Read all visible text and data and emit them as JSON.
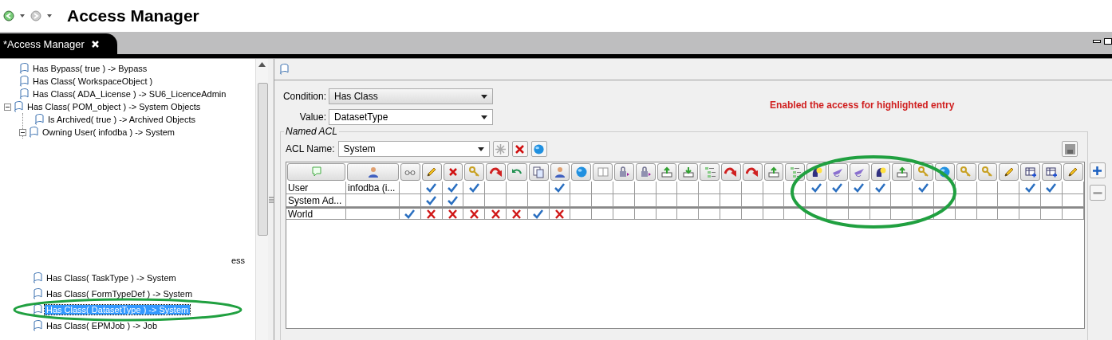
{
  "toolbar": {
    "title": "Access Manager"
  },
  "tab": {
    "label": "*Access Manager"
  },
  "tree": {
    "items": [
      {
        "label": "Has Bypass( true ) -> Bypass",
        "expanded": false,
        "selected": false
      },
      {
        "label": "Has Class( WorkspaceObject )",
        "expanded": false,
        "selected": false
      },
      {
        "label": "Has Class( ADA_License ) -> SU6_LicenceAdmin",
        "expanded": false,
        "selected": false
      },
      {
        "label": "Has Class( POM_object ) -> System Objects",
        "expanded": true,
        "selected": false,
        "children": [
          {
            "label": "Is Archived( true ) -> Archived Objects",
            "expanded": false,
            "selected": false
          },
          {
            "label": "Owning User( infodba ) -> System",
            "expanded": true,
            "selected": false
          }
        ]
      }
    ],
    "fragment": "ess",
    "lower_items": [
      {
        "label": "Has Class( TaskType ) -> System",
        "selected": false
      },
      {
        "label": "Has Class( FormTypeDef ) -> System",
        "selected": false
      },
      {
        "label": "Has Class( DatasetType ) -> System",
        "selected": true
      },
      {
        "label": "Has Class( EPMJob ) -> Job",
        "selected": false
      }
    ]
  },
  "detail": {
    "condition_label": "Condition:",
    "condition": "Has Class",
    "value_label": "Value:",
    "value": "DatasetType",
    "note": "Enabled the access for highlighted entry",
    "group_title": "Named ACL",
    "acl_label": "ACL Name:",
    "acl": "System"
  },
  "acl_table": {
    "rows": [
      {
        "type": "User",
        "name": "infodba (i...",
        "cells": [
          {
            "kind": "empty"
          },
          {
            "kind": "check"
          },
          {
            "kind": "check"
          },
          {
            "kind": "check"
          },
          {
            "kind": "empty"
          },
          {
            "kind": "empty"
          },
          {
            "kind": "empty"
          },
          {
            "kind": "check"
          },
          {
            "kind": "empty"
          },
          {
            "kind": "empty"
          },
          {
            "kind": "empty"
          },
          {
            "kind": "empty"
          },
          {
            "kind": "empty"
          },
          {
            "kind": "empty"
          },
          {
            "kind": "empty"
          },
          {
            "kind": "empty"
          },
          {
            "kind": "empty"
          },
          {
            "kind": "empty"
          },
          {
            "kind": "empty"
          },
          {
            "kind": "check"
          },
          {
            "kind": "check"
          },
          {
            "kind": "check"
          },
          {
            "kind": "check"
          },
          {
            "kind": "empty"
          },
          {
            "kind": "check"
          },
          {
            "kind": "empty"
          },
          {
            "kind": "empty"
          },
          {
            "kind": "empty"
          },
          {
            "kind": "empty"
          },
          {
            "kind": "check"
          },
          {
            "kind": "check"
          },
          {
            "kind": "empty"
          }
        ]
      },
      {
        "type": "System Ad...",
        "cells": [
          {
            "kind": "empty"
          },
          {
            "kind": "check"
          },
          {
            "kind": "check"
          },
          {
            "kind": "empty"
          },
          {
            "kind": "empty"
          },
          {
            "kind": "empty"
          },
          {
            "kind": "empty"
          },
          {
            "kind": "empty"
          },
          {
            "kind": "empty"
          },
          {
            "kind": "empty"
          },
          {
            "kind": "empty"
          },
          {
            "kind": "empty"
          },
          {
            "kind": "empty"
          },
          {
            "kind": "empty"
          },
          {
            "kind": "empty"
          },
          {
            "kind": "empty"
          },
          {
            "kind": "empty"
          },
          {
            "kind": "empty"
          },
          {
            "kind": "empty"
          },
          {
            "kind": "empty"
          },
          {
            "kind": "empty"
          },
          {
            "kind": "empty"
          },
          {
            "kind": "empty"
          },
          {
            "kind": "empty"
          },
          {
            "kind": "empty"
          },
          {
            "kind": "empty"
          },
          {
            "kind": "empty"
          },
          {
            "kind": "empty"
          },
          {
            "kind": "empty"
          },
          {
            "kind": "empty"
          },
          {
            "kind": "empty"
          },
          {
            "kind": "empty"
          }
        ]
      },
      {
        "type": "World",
        "cells": [
          {
            "kind": "check"
          },
          {
            "kind": "cross"
          },
          {
            "kind": "cross"
          },
          {
            "kind": "cross"
          },
          {
            "kind": "cross"
          },
          {
            "kind": "cross"
          },
          {
            "kind": "check"
          },
          {
            "kind": "cross"
          },
          {
            "kind": "empty"
          },
          {
            "kind": "empty"
          },
          {
            "kind": "empty"
          },
          {
            "kind": "empty"
          },
          {
            "kind": "empty"
          },
          {
            "kind": "empty"
          },
          {
            "kind": "empty"
          },
          {
            "kind": "empty"
          },
          {
            "kind": "empty"
          },
          {
            "kind": "empty"
          },
          {
            "kind": "empty"
          },
          {
            "kind": "empty"
          },
          {
            "kind": "empty"
          },
          {
            "kind": "empty"
          },
          {
            "kind": "empty"
          },
          {
            "kind": "empty"
          },
          {
            "kind": "empty"
          },
          {
            "kind": "empty"
          },
          {
            "kind": "empty"
          },
          {
            "kind": "empty"
          },
          {
            "kind": "empty"
          },
          {
            "kind": "empty"
          },
          {
            "kind": "empty"
          },
          {
            "kind": "empty"
          }
        ]
      }
    ]
  }
}
